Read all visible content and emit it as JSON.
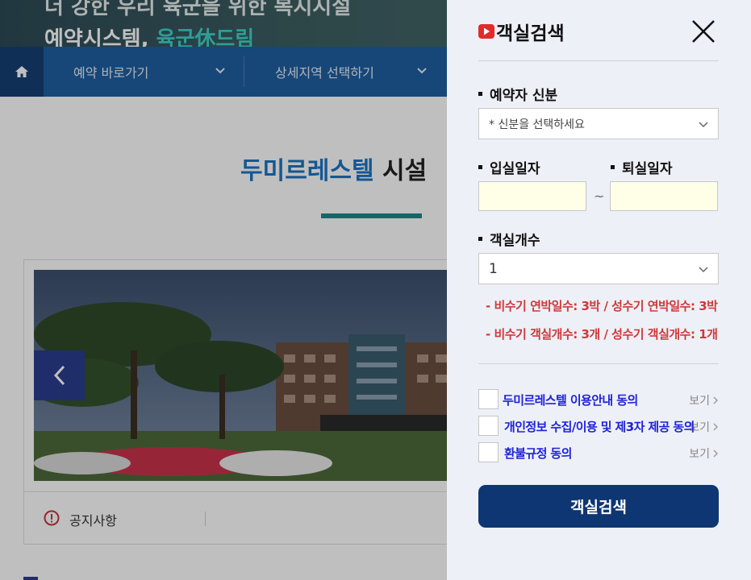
{
  "background": {
    "hero": {
      "line1": "더 강한 우리 육군을 위한 복지시설",
      "line2_prefix": "예약시스템, ",
      "line2_accent": "육군休드림"
    },
    "nav": {
      "home_icon": "home-icon",
      "items": [
        {
          "label": "예약 바로가기"
        },
        {
          "label": "상세지역 선택하기"
        }
      ]
    },
    "page_title": {
      "blue": "두미르레스텔",
      "dark": " 시설"
    },
    "notice_label": "공지사항"
  },
  "panel": {
    "title": "객실검색",
    "title_icon": "play-icon",
    "fields": {
      "identity_label": "예약자 신분",
      "identity_placeholder": "* 신분을 선택하세요",
      "checkin_label": "입실일자",
      "checkout_label": "퇴실일자",
      "checkin_value": "",
      "checkout_value": "",
      "tilde": "~",
      "rooms_label": "객실개수",
      "rooms_value": "1"
    },
    "notices": [
      "- 비수기 연박일수: 3박 / 성수기 연박일수: 3박",
      "- 비수기 객실개수: 3개 / 성수기 객실개수: 1개"
    ],
    "agreements": [
      {
        "label": "두미르레스텔 이용안내 동의",
        "view": "보기"
      },
      {
        "label": "개인정보 수집/이용 및 제3자 제공 동의",
        "view": "보기"
      },
      {
        "label": "환불규정 동의",
        "view": "보기"
      }
    ],
    "search_button": "객실검색"
  },
  "colors": {
    "panel_bg": "#eef0f7",
    "search_button": "#0e3672",
    "notice_red": "#d0383a",
    "agree_link": "#1d22d8",
    "nav_bar": "#1f5fa0"
  }
}
